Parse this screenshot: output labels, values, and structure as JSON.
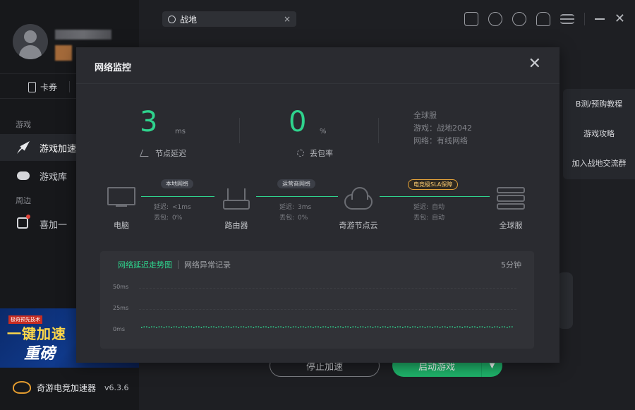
{
  "sidebar": {
    "coupon_label": "卡券",
    "section_games": "游戏",
    "section_around": "周边",
    "nav": [
      {
        "label": "游戏加速"
      },
      {
        "label": "游戏库"
      },
      {
        "label": "喜加一"
      }
    ],
    "banner": {
      "tag": "极奇预先技术",
      "line1": "一键加速",
      "line2": "重磅"
    },
    "app_name": "奇游电竞加速器",
    "version": "v6.3.6"
  },
  "topbar": {
    "search_value": "战地",
    "clear_glyph": "×"
  },
  "side_panel": {
    "items": [
      "B测/预购教程",
      "游戏攻略",
      "加入战地交流群"
    ]
  },
  "buttons": {
    "stop": "停止加速",
    "launch": "启动游戏"
  },
  "modal": {
    "title": "网络监控",
    "close_glyph": "✕",
    "latency": {
      "value": "3",
      "unit": "ms",
      "label": "节点延迟"
    },
    "loss": {
      "value": "0",
      "unit": "%",
      "label": "丢包率"
    },
    "info": {
      "region": "全球服",
      "game": "游戏：战地2042",
      "network": "网络：有线网络"
    },
    "nodes": [
      "电脑",
      "路由器",
      "奇游节点云",
      "全球服"
    ],
    "links": [
      {
        "tag": "本地网络",
        "delay_label": "延迟:",
        "delay": "<1ms",
        "loss_label": "丢包:",
        "loss": "0%"
      },
      {
        "tag": "运营商网络",
        "delay_label": "延迟:",
        "delay": "3ms",
        "loss_label": "丢包:",
        "loss": "0%"
      },
      {
        "tag": "电竞级SLA保障",
        "delay_label": "延迟:",
        "delay": "自动",
        "loss_label": "丢包:",
        "loss": "自动"
      }
    ],
    "chart": {
      "tab_active": "网络延迟走势图",
      "tab_other": "网络异常记录",
      "period": "5分钟",
      "yticks": [
        "50ms",
        "25ms",
        "0ms"
      ]
    }
  },
  "chart_data": {
    "type": "scatter",
    "title": "",
    "ylabel": "",
    "ylim": [
      0,
      50
    ],
    "series": [
      {
        "values": [
          3,
          3,
          3,
          3,
          3,
          3,
          3,
          3,
          3,
          3,
          3,
          3,
          3,
          3,
          3,
          3,
          3,
          3,
          3,
          3,
          3,
          3,
          3,
          3,
          3,
          3,
          3,
          3,
          3,
          3,
          3,
          3,
          3,
          3,
          3,
          3,
          3,
          3,
          3,
          3,
          3,
          3,
          3,
          3,
          3,
          3,
          3,
          3,
          3,
          3,
          3,
          3,
          3,
          3,
          3,
          3,
          3,
          3,
          3,
          3,
          3,
          3,
          3,
          3,
          3,
          3,
          3,
          3,
          3,
          3,
          3,
          3,
          3,
          3,
          3,
          3,
          3,
          3,
          3,
          3,
          3,
          3,
          3,
          3,
          3,
          3,
          3,
          3,
          3,
          3,
          3,
          3,
          3,
          3,
          3,
          3,
          3,
          3,
          3,
          3,
          3,
          3,
          3,
          3,
          3,
          3,
          3,
          3,
          3,
          3,
          3,
          3,
          3,
          3,
          3,
          3,
          3,
          3,
          3,
          3,
          3,
          3,
          3,
          3,
          3,
          3,
          3,
          3,
          3,
          3,
          3,
          3,
          3,
          3,
          3,
          3,
          3,
          3,
          3,
          3,
          3,
          3,
          3,
          3,
          3,
          3,
          3,
          3,
          3,
          3
        ]
      }
    ]
  },
  "colors": {
    "accent": "#2fd38d",
    "sla": "#e3a23a"
  }
}
